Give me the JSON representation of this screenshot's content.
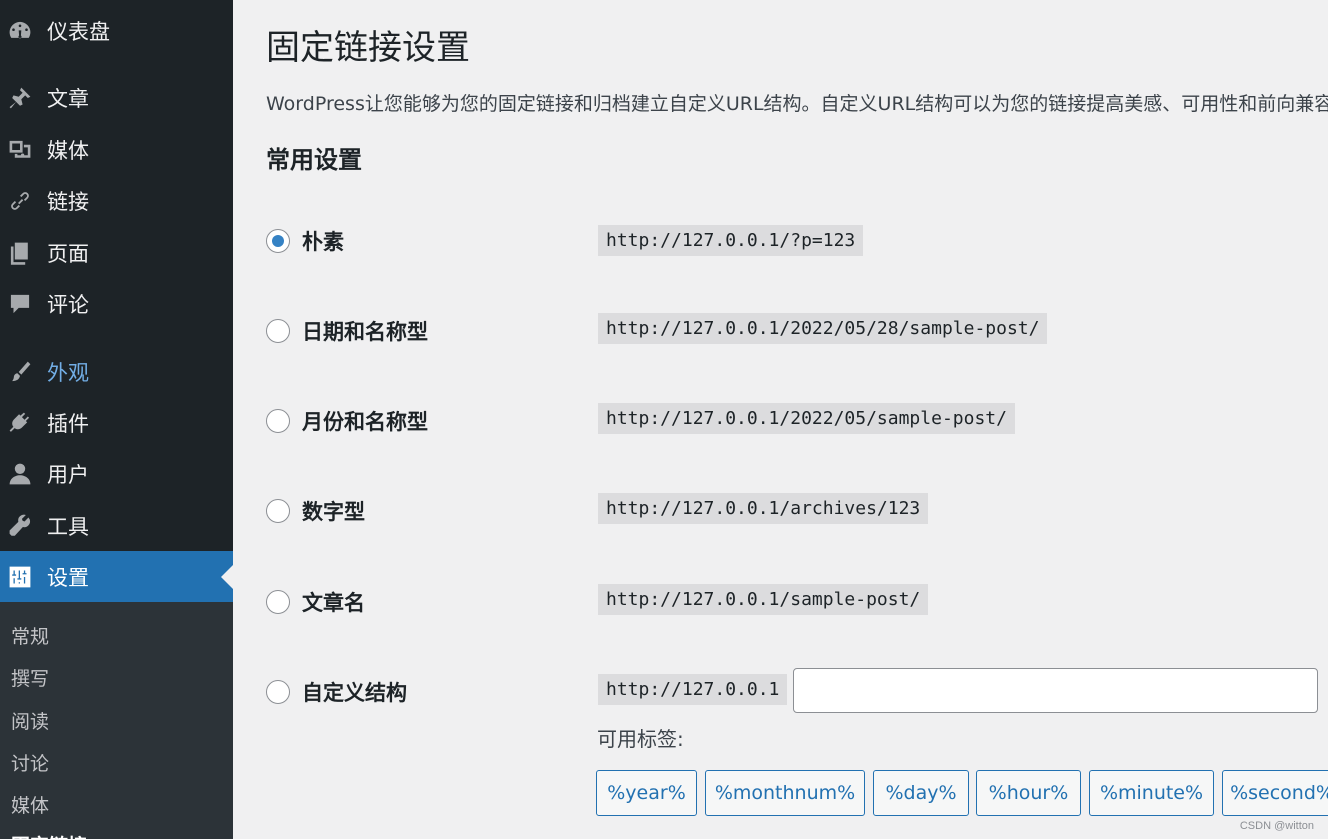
{
  "sidebar": {
    "items": [
      {
        "label": "仪表盘",
        "icon": "dashboard-icon"
      },
      {
        "label": "文章",
        "icon": "pushpin-icon"
      },
      {
        "label": "媒体",
        "icon": "media-icon"
      },
      {
        "label": "链接",
        "icon": "link-icon"
      },
      {
        "label": "页面",
        "icon": "page-icon"
      },
      {
        "label": "评论",
        "icon": "comment-icon"
      },
      {
        "label": "外观",
        "icon": "paintbrush-icon"
      },
      {
        "label": "插件",
        "icon": "plugin-icon"
      },
      {
        "label": "用户",
        "icon": "user-icon"
      },
      {
        "label": "工具",
        "icon": "wrench-icon"
      },
      {
        "label": "设置",
        "icon": "settings-icon"
      }
    ],
    "submenu": [
      "常规",
      "撰写",
      "阅读",
      "讨论",
      "媒体",
      "固定链接"
    ]
  },
  "main": {
    "title": "固定链接设置",
    "intro": "WordPress让您能够为您的固定链接和归档建立自定义URL结构。自定义URL结构可以为您的链接提高美感、可用性和前向兼容性",
    "section_title": "常用设置",
    "options": [
      {
        "label": "朴素",
        "url": "http://127.0.0.1/?p=123",
        "checked": true
      },
      {
        "label": "日期和名称型",
        "url": "http://127.0.0.1/2022/05/28/sample-post/",
        "checked": false
      },
      {
        "label": "月份和名称型",
        "url": "http://127.0.0.1/2022/05/sample-post/",
        "checked": false
      },
      {
        "label": "数字型",
        "url": "http://127.0.0.1/archives/123",
        "checked": false
      },
      {
        "label": "文章名",
        "url": "http://127.0.0.1/sample-post/",
        "checked": false
      },
      {
        "label": "自定义结构",
        "url": "http://127.0.0.1",
        "checked": false
      }
    ],
    "custom_structure_value": "",
    "available_tags_label": "可用标签:",
    "tags": [
      "%year%",
      "%monthnum%",
      "%day%",
      "%hour%",
      "%minute%",
      "%second%"
    ]
  },
  "colors": {
    "sidebar_bg": "#1d2327",
    "submenu_bg": "#2c3338",
    "accent": "#2271b1",
    "highlight_text": "#72aee6",
    "page_bg": "#f0f0f1"
  },
  "watermark": "CSDN @witton"
}
